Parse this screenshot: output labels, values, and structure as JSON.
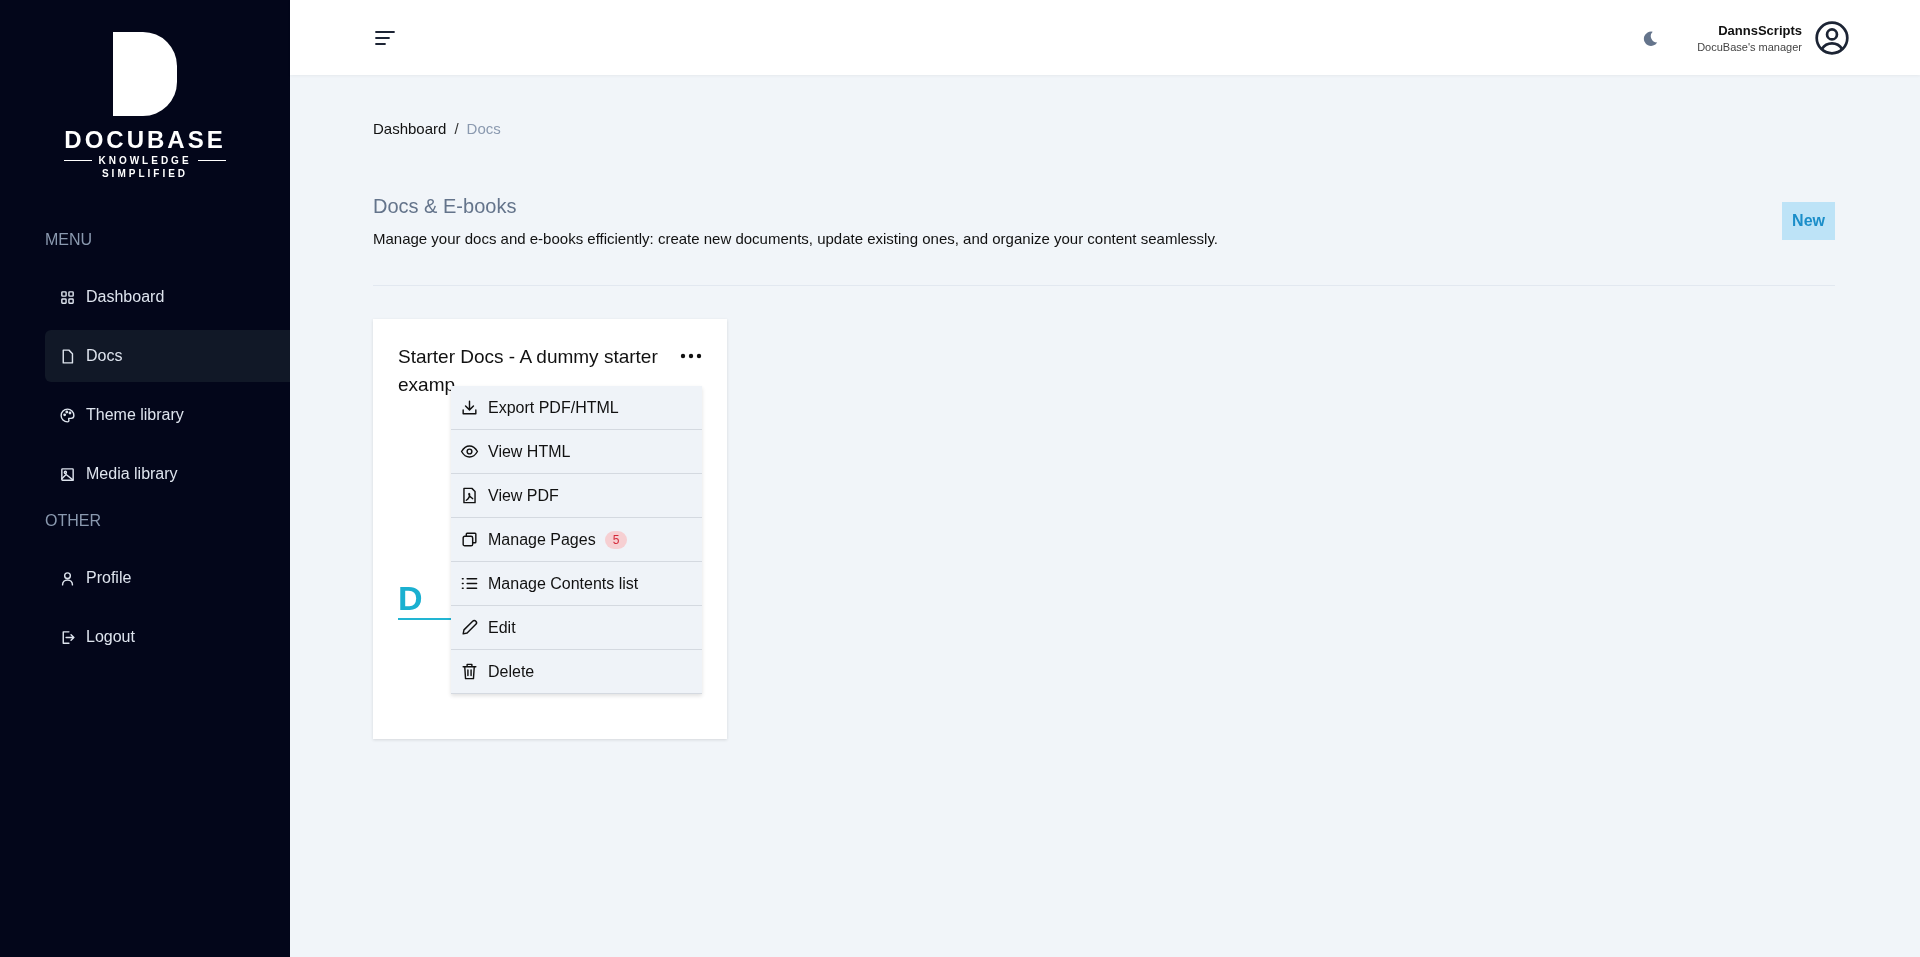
{
  "brand": {
    "name": "DOCUBASE",
    "tagline_1": "KNOWLEDGE",
    "tagline_2": "SIMPLIFIED"
  },
  "sidebar": {
    "sections": [
      {
        "label": "MENU",
        "items": [
          {
            "label": "Dashboard",
            "selected": false
          },
          {
            "label": "Docs",
            "selected": true
          },
          {
            "label": "Theme library",
            "selected": false
          },
          {
            "label": "Media library",
            "selected": false
          }
        ]
      },
      {
        "label": "OTHER",
        "items": [
          {
            "label": "Profile",
            "selected": false
          },
          {
            "label": "Logout",
            "selected": false
          }
        ]
      }
    ]
  },
  "header": {
    "user_name": "DannsScripts",
    "user_role": "DocuBase's manager"
  },
  "breadcrumb": {
    "separator": "/",
    "items": [
      {
        "label": "Dashboard",
        "current": false
      },
      {
        "label": "Docs",
        "current": true
      }
    ]
  },
  "page": {
    "title": "Docs & E-books",
    "description": "Manage your docs and e-books efficiently: create new documents, update existing ones, and organize your content seamlessly.",
    "new_button": "New"
  },
  "docs": [
    {
      "title": "Starter Docs - A dummy starter examp",
      "cover_letter": "D",
      "menu": [
        {
          "label": "Export PDF/HTML"
        },
        {
          "label": "View HTML"
        },
        {
          "label": "View PDF"
        },
        {
          "label": "Manage Pages",
          "badge": "5"
        },
        {
          "label": "Manage Contents list"
        },
        {
          "label": "Edit"
        },
        {
          "label": "Delete"
        }
      ]
    }
  ]
}
